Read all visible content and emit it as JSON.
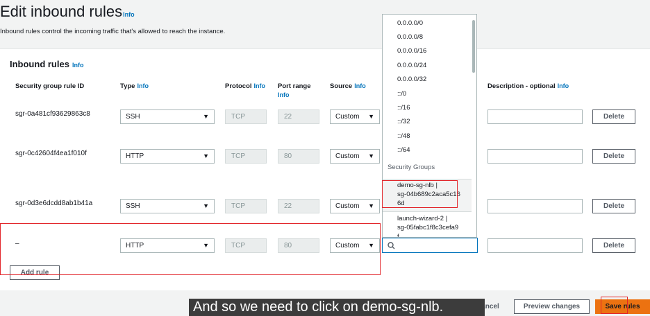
{
  "page": {
    "title": "Edit inbound rules",
    "title_info": "Info",
    "subtitle": "Inbound rules control the incoming traffic that's allowed to reach the instance."
  },
  "panel": {
    "title": "Inbound rules",
    "info": "Info",
    "columns": {
      "rule_id": "Security group rule ID",
      "type": "Type",
      "protocol": "Protocol",
      "port_range": "Port range",
      "source": "Source",
      "description": "Description - optional",
      "info": "Info"
    }
  },
  "rules": [
    {
      "id": "sgr-0a481cf93629863c8",
      "type": "SSH",
      "protocol": "TCP",
      "port": "22",
      "source": "Custom",
      "delete": "Delete"
    },
    {
      "id": "sgr-0c42604f4ea1f010f",
      "type": "HTTP",
      "protocol": "TCP",
      "port": "80",
      "source": "Custom",
      "delete": "Delete"
    },
    {
      "id": "sgr-0d3e6dcdd8ab1b41a",
      "type": "SSH",
      "protocol": "TCP",
      "port": "22",
      "source": "Custom",
      "delete": "Delete"
    },
    {
      "id": "–",
      "type": "HTTP",
      "protocol": "TCP",
      "port": "80",
      "source": "Custom",
      "delete": "Delete"
    }
  ],
  "add_rule": "Add rule",
  "dropdown": {
    "cidr_options": [
      "0.0.0.0/0",
      "0.0.0.0/8",
      "0.0.0.0/16",
      "0.0.0.0/24",
      "0.0.0.0/32",
      "::/0",
      "::/16",
      "::/32",
      "::/48",
      "::/64"
    ],
    "group_label": "Security Groups",
    "sg_options": [
      {
        "line1": "demo-sg-nlb |",
        "line2": "sg-04b689c2aca5c16",
        "line3": "6d"
      },
      {
        "line1": "launch-wizard-2 |",
        "line2": "sg-05fabc1f8c3cefa9",
        "line3": "f"
      }
    ],
    "search_value": ""
  },
  "footer": {
    "cancel": "Cancel",
    "preview": "Preview changes",
    "save": "Save rules"
  },
  "caption": "And so we need to click on demo-sg-nlb.",
  "colors": {
    "link": "#0073bb",
    "save": "#ec7211",
    "highlight_box": "#e2262b"
  }
}
